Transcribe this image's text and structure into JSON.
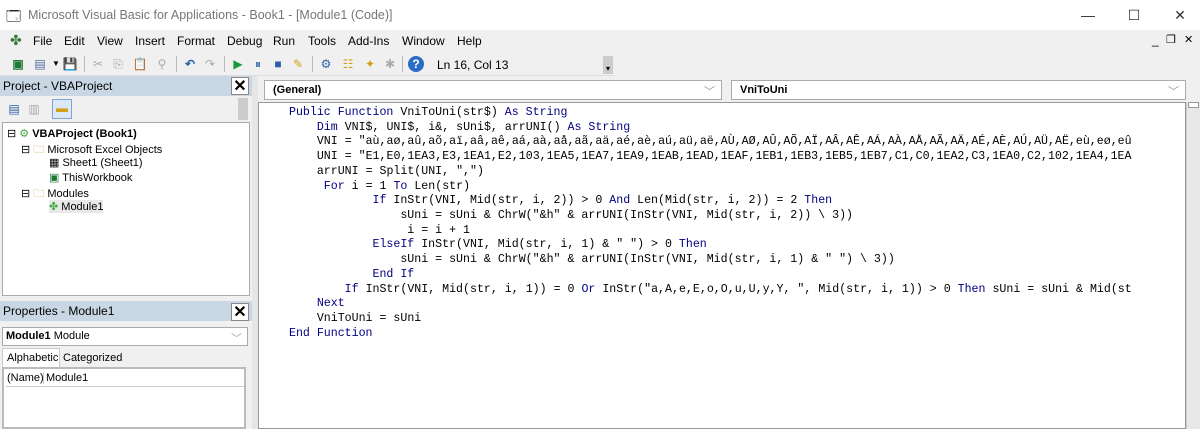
{
  "window": {
    "title": "Microsoft Visual Basic for Applications - Book1 - [Module1 (Code)]"
  },
  "menu": [
    "File",
    "Edit",
    "View",
    "Insert",
    "Format",
    "Debug",
    "Run",
    "Tools",
    "Add-Ins",
    "Window",
    "Help"
  ],
  "toolbar": {
    "position": "Ln 16, Col 13"
  },
  "project": {
    "title": "Project - VBAProject",
    "tree": {
      "root": "VBAProject (Book1)",
      "folder1": "Microsoft Excel Objects",
      "sheet1": "Sheet1 (Sheet1)",
      "workbook": "ThisWorkbook",
      "folder2": "Modules",
      "module1": "Module1"
    }
  },
  "properties": {
    "title": "Properties - Module1",
    "object_name": "Module1",
    "object_type": "Module",
    "tab_alpha": "Alphabetic",
    "tab_cat": "Categorized",
    "prop_name": "(Name)",
    "prop_value": "Module1"
  },
  "code_window": {
    "object_dropdown": "(General)",
    "proc_dropdown": "VniToUni",
    "lines": [
      "Public Function VniToUni(str$) As String",
      "    Dim VNI$, UNI$, i&, sUni$, arrUNI() As String",
      "    VNI = \"aù,aø,aû,aõ,aï,aâ,aê,aá,aà,aå,aã,aä,aé,aè,aú,aü,aë,AÙ,AØ,AÛ,AÕ,AÏ,AÂ,AÊ,AÁ,AÀ,AÅ,AÃ,AÄ,AÉ,AÈ,AÚ,AÜ,AË,eù,eø,eû",
      "    UNI = \"E1,E0,1EA3,E3,1EA1,E2,103,1EA5,1EA7,1EA9,1EAB,1EAD,1EAF,1EB1,1EB3,1EB5,1EB7,C1,C0,1EA2,C3,1EA0,C2,102,1EA4,1EA",
      "    arrUNI = Split(UNI, \",\")",
      "     For i = 1 To Len(str)",
      "            If InStr(VNI, Mid(str, i, 2)) > 0 And Len(Mid(str, i, 2)) = 2 Then",
      "                sUni = sUni & ChrW(\"&h\" & arrUNI(InStr(VNI, Mid(str, i, 2)) \\ 3))",
      "                 i = i + 1",
      "            ElseIf InStr(VNI, Mid(str, i, 1) & \" \") > 0 Then",
      "                sUni = sUni & ChrW(\"&h\" & arrUNI(InStr(VNI, Mid(str, i, 1) & \" \") \\ 3))",
      "            End If",
      "        If InStr(VNI, Mid(str, i, 1)) = 0 Or InStr(\"a,A,e,E,o,O,u,U,y,Y, \", Mid(str, i, 1)) > 0 Then sUni = sUni & Mid(st",
      "    Next",
      "    VniToUni = sUni",
      "End Function"
    ]
  }
}
